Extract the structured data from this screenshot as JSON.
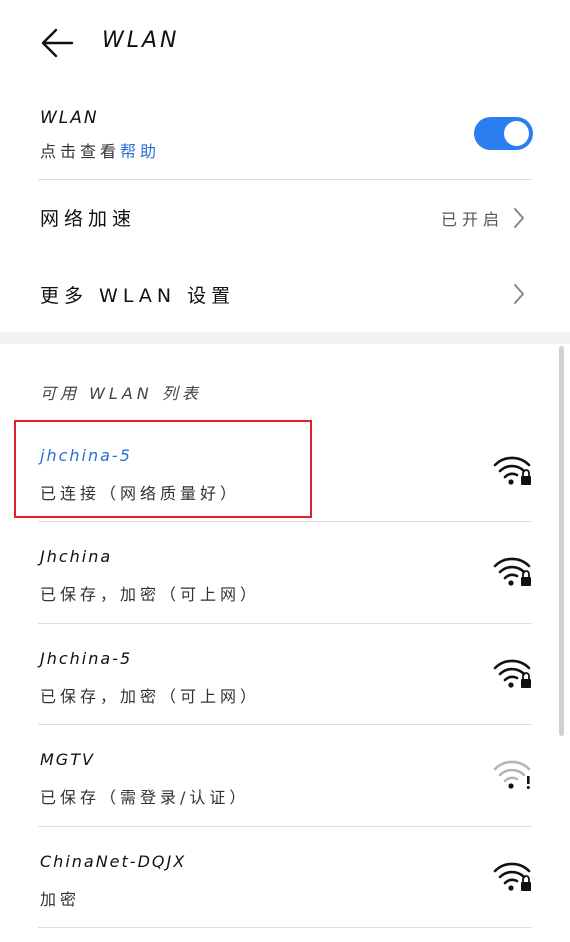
{
  "header": {
    "title": "WLAN"
  },
  "wlan": {
    "title": "WLAN",
    "subtitle_prefix": "点击查看",
    "help_link": "帮助",
    "enabled": true,
    "accent_color": "#2a7ef0"
  },
  "settings": [
    {
      "label": "网络加速",
      "value": "已开启"
    },
    {
      "label": "更多 WLAN 设置",
      "value": ""
    }
  ],
  "available_section": {
    "label": "可用 WLAN 列表"
  },
  "networks": [
    {
      "name": "jhchina-5",
      "status": "已连接（网络质量好）",
      "icon": "wifi-lock-icon",
      "connected": true
    },
    {
      "name": "Jhchina",
      "status": "已保存，加密（可上网）",
      "icon": "wifi-lock-icon",
      "connected": false
    },
    {
      "name": "Jhchina-5",
      "status": "已保存，加密（可上网）",
      "icon": "wifi-lock-icon",
      "connected": false
    },
    {
      "name": "MGTV",
      "status": "已保存（需登录/认证）",
      "icon": "wifi-warning-icon",
      "connected": false
    },
    {
      "name": "ChinaNet-DQJX",
      "status": "加密",
      "icon": "wifi-lock-icon",
      "connected": false
    }
  ]
}
